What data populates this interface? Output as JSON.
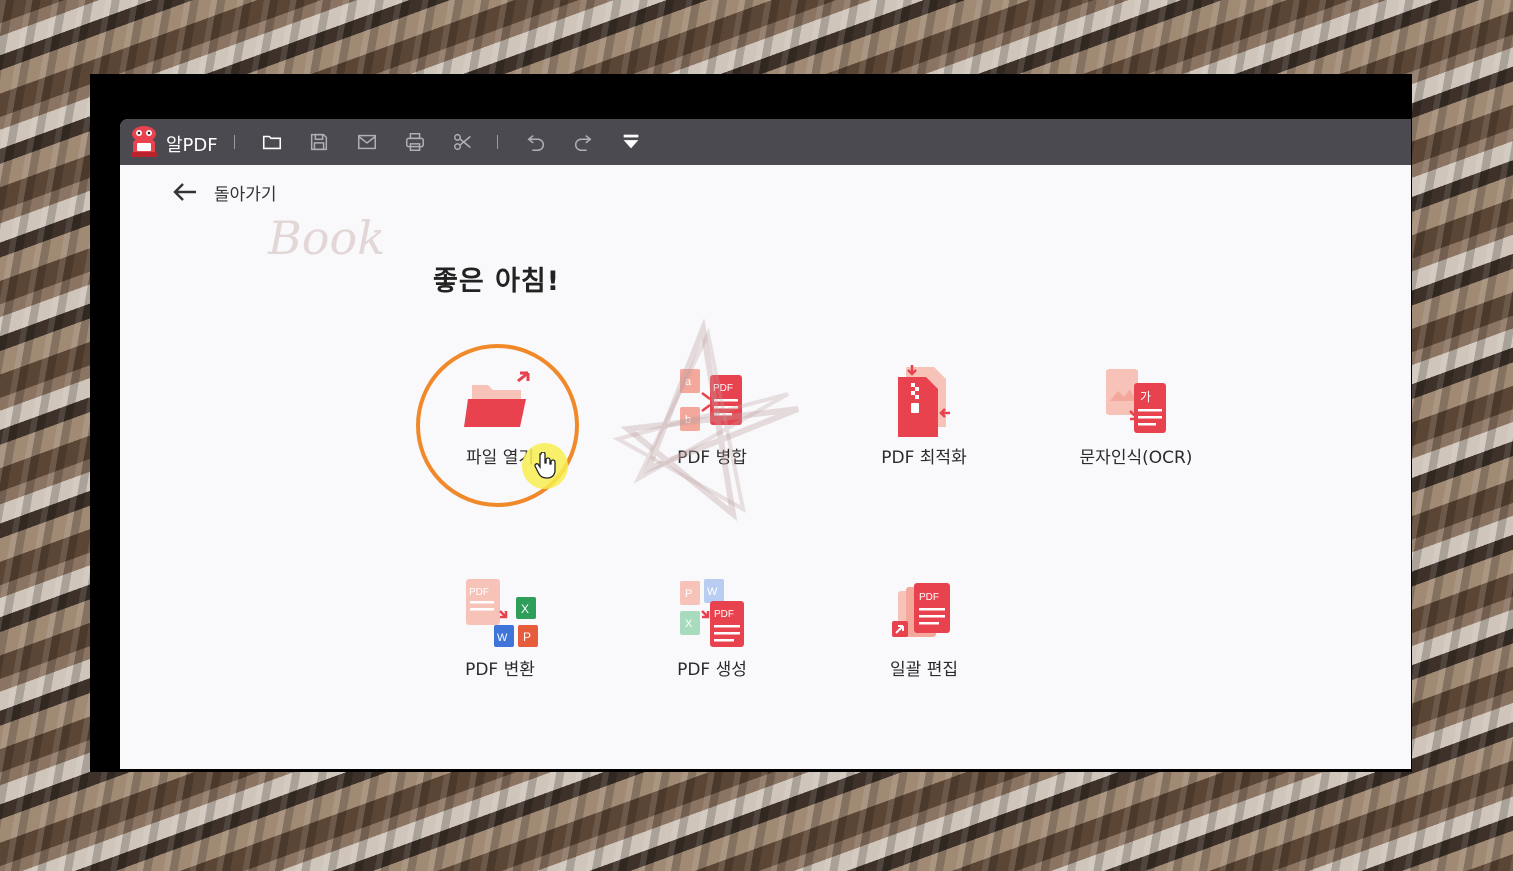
{
  "app": {
    "name": "알PDF"
  },
  "nav": {
    "back_label": "돌아가기"
  },
  "greeting": "좋은 아침!",
  "toolbar": {
    "icons": [
      "folder-icon",
      "save-icon",
      "mail-icon",
      "print-icon",
      "scissors-icon",
      "undo-icon",
      "redo-icon",
      "dropdown-icon"
    ]
  },
  "tiles": [
    {
      "label": "파일 열기",
      "icon": "open-folder-icon"
    },
    {
      "label": "PDF 병합",
      "icon": "merge-pdf-icon"
    },
    {
      "label": "PDF 최적화",
      "icon": "zip-pdf-icon"
    },
    {
      "label": "문자인식(OCR)",
      "icon": "ocr-icon"
    },
    {
      "label": "PDF 변환",
      "icon": "convert-pdf-icon"
    },
    {
      "label": "PDF 생성",
      "icon": "create-pdf-icon"
    },
    {
      "label": "일괄 편집",
      "icon": "batch-edit-icon"
    }
  ],
  "watermark": {
    "text": "Book"
  },
  "colors": {
    "accent_red": "#e8424e",
    "light_red": "#f4a79b",
    "highlight": "#f0892a",
    "titlebar": "#4b4a50"
  }
}
